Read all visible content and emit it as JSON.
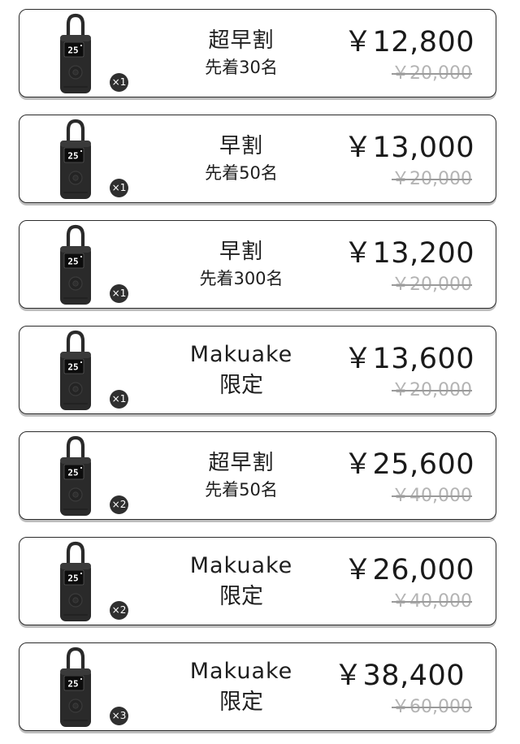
{
  "colors": {
    "border": "#2b2b2b",
    "price_text": "#1a1a1a",
    "original_price_text": "#b4b4b4",
    "badge_bg": "#2f2f2f",
    "badge_text": "#ffffff",
    "product_body": "#2a2a2a",
    "display_bg": "#0c0c0c"
  },
  "plans": [
    {
      "quantity": "×1",
      "title": "超早割",
      "subtitle": "先着30名",
      "price": "￥12,800",
      "original_price": "￥20,000",
      "product_icon": "tire-inflator-icon"
    },
    {
      "quantity": "×1",
      "title": "早割",
      "subtitle": "先着50名",
      "price": "￥13,000",
      "original_price": "￥20,000",
      "product_icon": "tire-inflator-icon"
    },
    {
      "quantity": "×1",
      "title": "早割",
      "subtitle": "先着300名",
      "price": "￥13,200",
      "original_price": "￥20,000",
      "product_icon": "tire-inflator-icon"
    },
    {
      "quantity": "×1",
      "title": "Makuake",
      "subtitle": "限定",
      "price": "￥13,600",
      "original_price": "￥20,000",
      "product_icon": "tire-inflator-icon"
    },
    {
      "quantity": "×2",
      "title": "超早割",
      "subtitle": "先着50名",
      "price": "￥25,600",
      "original_price": "￥40,000",
      "product_icon": "tire-inflator-icon"
    },
    {
      "quantity": "×2",
      "title": "Makuake",
      "subtitle": "限定",
      "price": "￥26,000",
      "original_price": "￥40,000",
      "product_icon": "tire-inflator-icon"
    },
    {
      "quantity": "×3",
      "title": "Makuake",
      "subtitle": "限定",
      "price": "￥38,400",
      "original_price": "￥60,000",
      "product_icon": "tire-inflator-icon"
    }
  ]
}
